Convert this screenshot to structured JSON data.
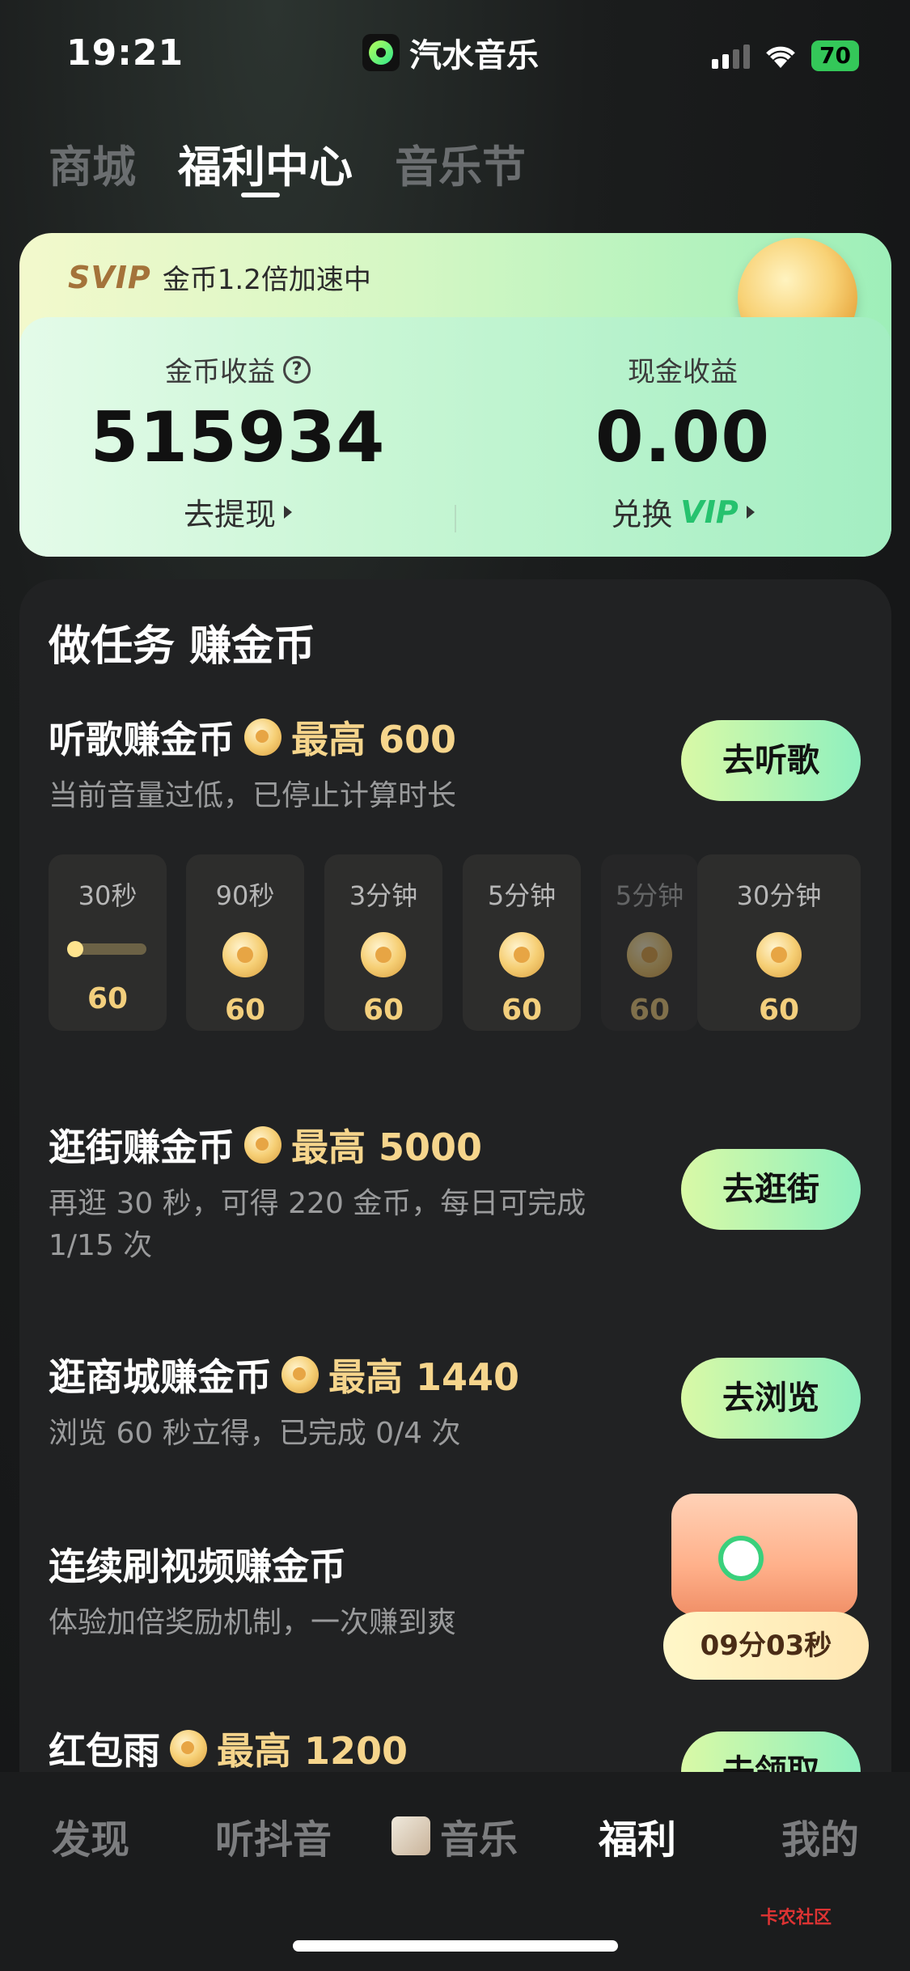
{
  "status_bar": {
    "time": "19:21",
    "app_name": "汽水音乐",
    "battery": "70"
  },
  "top_tabs": [
    {
      "label": "商城",
      "active": false
    },
    {
      "label": "福利中心",
      "active": true
    },
    {
      "label": "音乐节",
      "active": false
    }
  ],
  "coin_card": {
    "svip_badge": "SVIP",
    "svip_text": "金币1.2倍加速中",
    "coin_label": "金币收益",
    "coin_value": "515934",
    "coin_action": "去提现",
    "cash_label": "现金收益",
    "cash_value": "0.00",
    "cash_action_prefix": "兑换",
    "cash_action_vip": "VIP"
  },
  "tasks_section": {
    "title": "做任务 赚金币",
    "listen": {
      "title": "听歌赚金币",
      "max": "最高 600",
      "subtitle": "当前音量过低，已停止计算时长",
      "button": "去听歌",
      "chips": [
        {
          "label": "30秒",
          "value": "60",
          "progress": 0.05
        },
        {
          "label": "90秒",
          "value": "60"
        },
        {
          "label": "3分钟",
          "value": "60"
        },
        {
          "label": "5分钟",
          "value": "60"
        },
        {
          "label": "5分钟",
          "value": "60"
        },
        {
          "label": "30分钟",
          "value": "60"
        }
      ]
    },
    "browse_street": {
      "title": "逛街赚金币",
      "max": "最高 5000",
      "subtitle": "再逛 30 秒，可得 220 金币，每日可完成 1/15 次",
      "button": "去逛街"
    },
    "browse_mall": {
      "title": "逛商城赚金币",
      "max": "最高 1440",
      "subtitle": "浏览 60 秒立得，已完成 0/4 次",
      "button": "去浏览"
    },
    "video": {
      "title": "连续刷视频赚金币",
      "subtitle": "体验加倍奖励机制，一次赚到爽",
      "timer": "09分03秒"
    },
    "red_packet": {
      "title": "红包雨",
      "max": "最高 1200",
      "button": "去领取"
    }
  },
  "bottom_nav": [
    {
      "label": "发现",
      "active": false
    },
    {
      "label": "听抖音",
      "active": false
    },
    {
      "label": "音乐",
      "active": false
    },
    {
      "label": "福利",
      "active": true
    },
    {
      "label": "我的",
      "active": false
    }
  ],
  "watermark": "卡农社区"
}
